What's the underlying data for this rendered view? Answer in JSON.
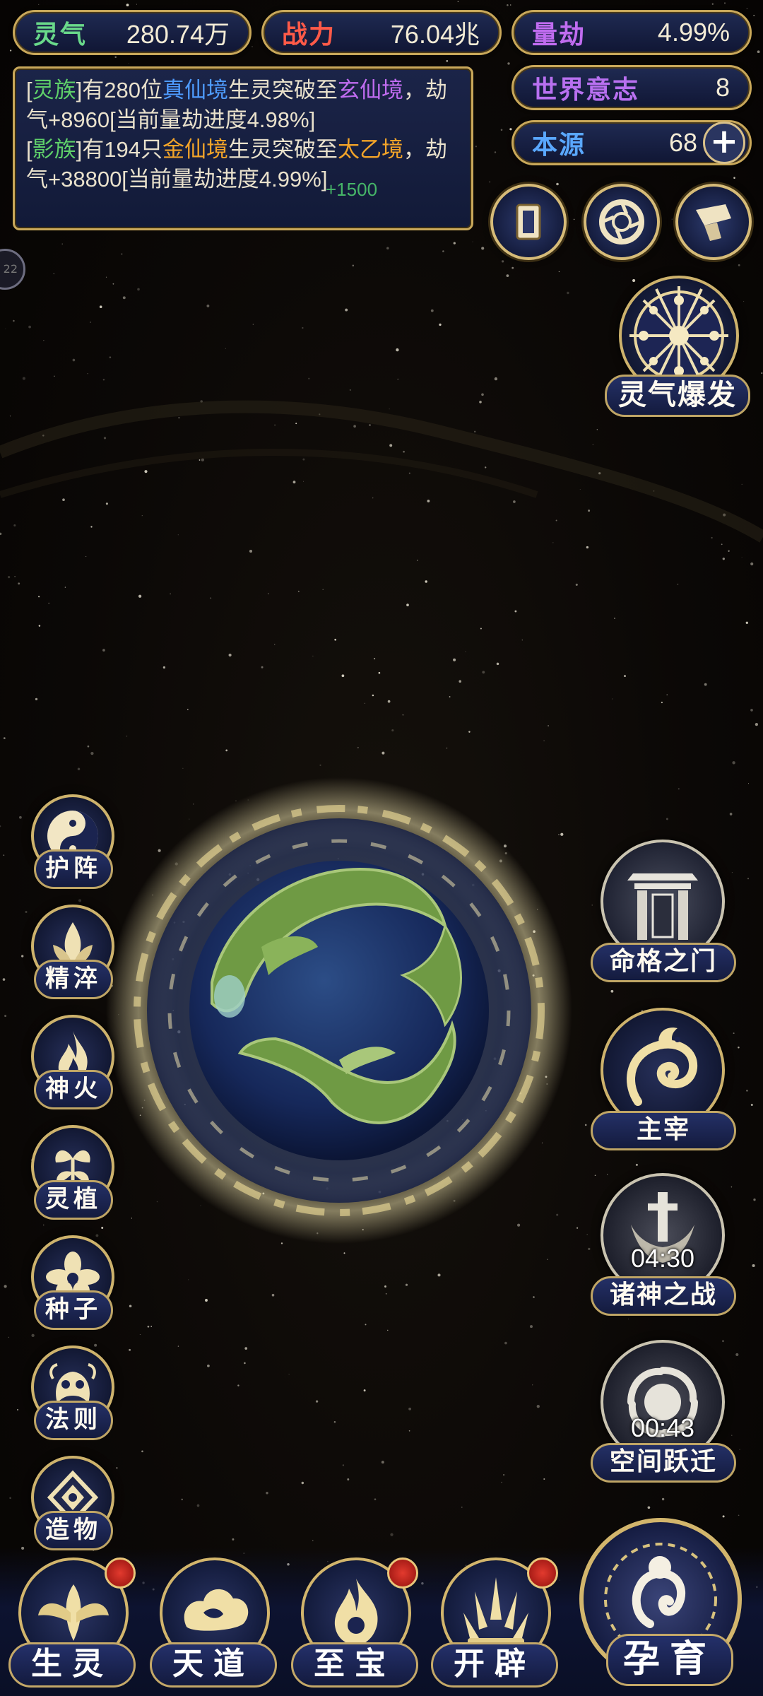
{
  "stats": {
    "lingqi": {
      "label": "灵气",
      "value": "280.74万",
      "color": "#69d98a"
    },
    "zhanli": {
      "label": "战力",
      "value": "76.04兆",
      "color": "#ff5a48"
    },
    "liangjie": {
      "label": "量劫",
      "value": "4.99%",
      "color": "#c06cf0"
    },
    "shijie_yizhi": {
      "label": "世界意志",
      "value": "8",
      "color": "#b870f0"
    },
    "benyuan": {
      "label": "本源",
      "value": "68",
      "color": "#5aa8ff",
      "plus": "+"
    }
  },
  "log": {
    "line1": {
      "open": "[",
      "race": "灵族",
      "close": "]",
      "t1": "有280位",
      "realm_from": "真仙境",
      "t2": "生灵突破至",
      "realm_to": "玄仙境",
      "t3": "，劫气+8960[当前量劫进度4.98%]"
    },
    "line2": {
      "open": "[",
      "race": "影族",
      "close": "]",
      "t1": "有194只",
      "realm_from": "金仙境",
      "t2": "生灵突破至",
      "realm_to": "太乙境",
      "t3": "，劫气+38800[当前量劫进度4.99%]"
    },
    "float_text": "+1500"
  },
  "edge_badge": "22",
  "right_top_buttons": [
    {
      "name": "cards-icon"
    },
    {
      "name": "portal-icon"
    },
    {
      "name": "scroll-icon"
    }
  ],
  "burst": {
    "label": "灵气爆发"
  },
  "left_menu": [
    {
      "key": "huzhen",
      "label": "护阵"
    },
    {
      "key": "jingcui",
      "label": "精淬"
    },
    {
      "key": "shenhuo",
      "label": "神火"
    },
    {
      "key": "lingzhi",
      "label": "灵植"
    },
    {
      "key": "zhongzi",
      "label": "种子"
    },
    {
      "key": "faze",
      "label": "法则"
    },
    {
      "key": "zaowu",
      "label": "造物"
    }
  ],
  "right_menu": {
    "mingge": {
      "label": "命格之门"
    },
    "zhuzai": {
      "label": "主宰"
    },
    "zhushen": {
      "label": "诸神之战",
      "timer": "04:30"
    },
    "kongjian": {
      "label": "空间跃迁",
      "timer": "00:43"
    }
  },
  "bottom_nav": [
    {
      "key": "shengling",
      "label": "生灵",
      "badge": true
    },
    {
      "key": "tiandao",
      "label": "天道",
      "badge": false
    },
    {
      "key": "zhibao",
      "label": "至宝",
      "badge": true
    },
    {
      "key": "kaipi",
      "label": "开辟",
      "badge": true
    }
  ],
  "yunyu": {
    "label": "孕育"
  }
}
